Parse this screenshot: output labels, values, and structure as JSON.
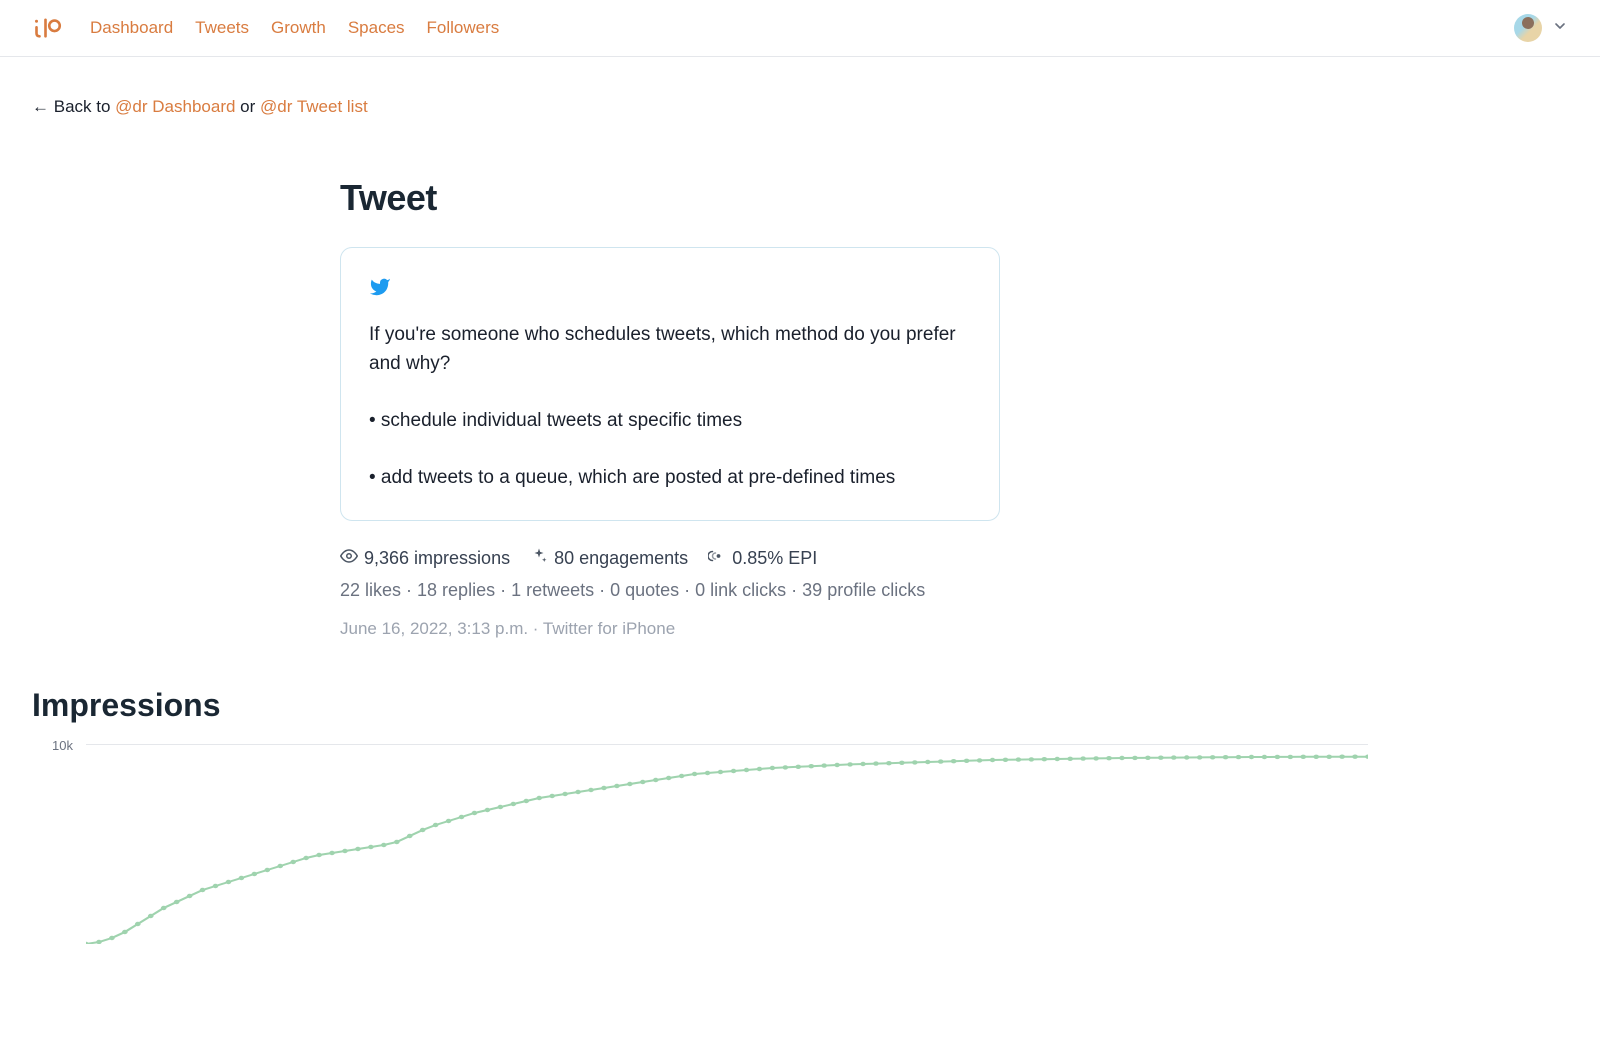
{
  "nav": {
    "items": [
      {
        "label": "Dashboard"
      },
      {
        "label": "Tweets"
      },
      {
        "label": "Growth"
      },
      {
        "label": "Spaces"
      },
      {
        "label": "Followers"
      }
    ]
  },
  "breadcrumb": {
    "arrow": "←",
    "back_to": "Back to",
    "link1": "@dr Dashboard",
    "or": "or",
    "link2": "@dr Tweet list"
  },
  "main": {
    "title": "Tweet",
    "tweet_text": "If you're someone who schedules tweets, which method do you prefer and why?\n\n• schedule individual tweets at specific times\n\n• add tweets to a queue, which are posted at pre-defined times"
  },
  "stats": {
    "impressions": "9,366 impressions",
    "engagements": "80 engagements",
    "epi": "0.85% EPI",
    "secondary": "22 likes · 18 replies · 1 retweets · 0 quotes · 0 link clicks · 39 profile clicks",
    "timestamp": "June 16, 2022, 3:13 p.m. · Twitter for iPhone"
  },
  "impressions_section": {
    "title": "Impressions",
    "y_tick": "10k"
  },
  "chart_data": {
    "type": "line",
    "title": "Impressions",
    "ylabel": "Impressions",
    "ylim": [
      0,
      10000
    ],
    "x": [
      0,
      1,
      2,
      3,
      4,
      5,
      6,
      7,
      8,
      9,
      10,
      11,
      12,
      13,
      14,
      15,
      16,
      17,
      18,
      19,
      20,
      21,
      22,
      23,
      24,
      25,
      26,
      27,
      28,
      29,
      30,
      31,
      32,
      33,
      34,
      35,
      36,
      37,
      38,
      39,
      40,
      41,
      42,
      43,
      44,
      45,
      46,
      47,
      48,
      49,
      50,
      51,
      52,
      53,
      54,
      55,
      56,
      57,
      58,
      59,
      60,
      61,
      62,
      63,
      64,
      65,
      66,
      67,
      68,
      69,
      70,
      71,
      72,
      73,
      74,
      75,
      76,
      77,
      78,
      79,
      80,
      81,
      82,
      83,
      84,
      85,
      86,
      87,
      88,
      89,
      90,
      91,
      92,
      93,
      94,
      95,
      96,
      97,
      98,
      99
    ],
    "values": [
      0,
      100,
      300,
      600,
      1000,
      1400,
      1800,
      2100,
      2400,
      2700,
      2900,
      3100,
      3300,
      3500,
      3700,
      3900,
      4100,
      4300,
      4450,
      4550,
      4650,
      4750,
      4850,
      4950,
      5100,
      5400,
      5700,
      5950,
      6150,
      6350,
      6550,
      6700,
      6850,
      7000,
      7150,
      7300,
      7400,
      7500,
      7600,
      7700,
      7800,
      7900,
      8000,
      8100,
      8200,
      8300,
      8400,
      8500,
      8550,
      8600,
      8650,
      8700,
      8750,
      8800,
      8830,
      8860,
      8890,
      8920,
      8950,
      8980,
      9000,
      9020,
      9040,
      9060,
      9080,
      9100,
      9120,
      9140,
      9160,
      9180,
      9200,
      9210,
      9220,
      9230,
      9240,
      9250,
      9260,
      9270,
      9280,
      9290,
      9300,
      9305,
      9310,
      9315,
      9320,
      9325,
      9330,
      9335,
      9340,
      9345,
      9350,
      9352,
      9354,
      9356,
      9358,
      9360,
      9362,
      9363,
      9364,
      9366
    ]
  }
}
